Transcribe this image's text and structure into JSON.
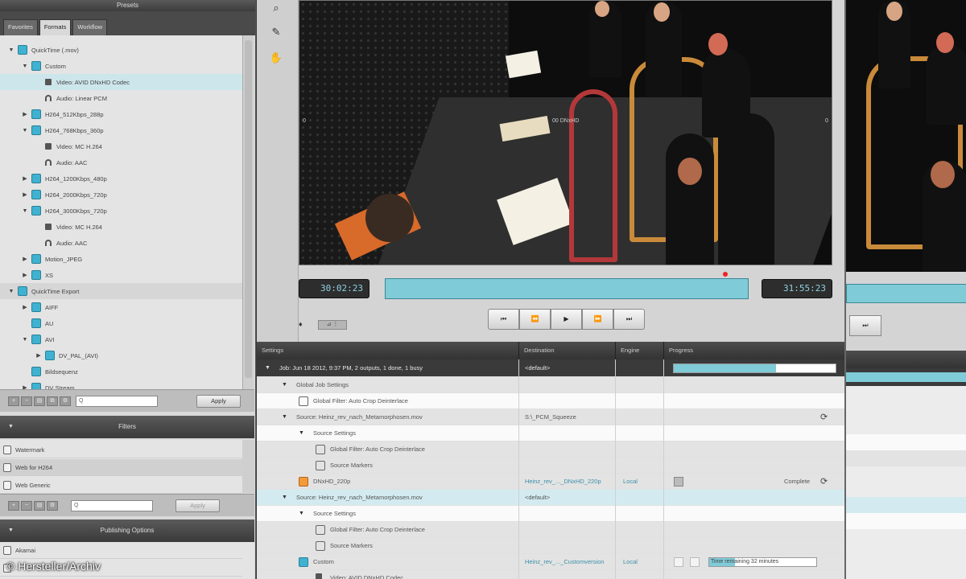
{
  "left": {
    "presets_title": "Presets",
    "tabs": [
      "Favorites",
      "Formats",
      "Workflow"
    ],
    "tree": [
      {
        "label": "QuickTime (.mov)",
        "indent": 0,
        "tri": "▼",
        "icon": "qt"
      },
      {
        "label": "Custom",
        "indent": 1,
        "tri": "▼",
        "icon": "qt"
      },
      {
        "label": "Video: AVID DNxHD Codec",
        "indent": 2,
        "tri": "",
        "icon": "film",
        "selected": true
      },
      {
        "label": "Audio: Linear PCM",
        "indent": 2,
        "tri": "",
        "icon": "audio"
      },
      {
        "label": "H264_512Kbps_288p",
        "indent": 1,
        "tri": "▶",
        "icon": "qt"
      },
      {
        "label": "H264_768Kbps_360p",
        "indent": 1,
        "tri": "▼",
        "icon": "qt"
      },
      {
        "label": "Video: MC H.264",
        "indent": 2,
        "tri": "",
        "icon": "film"
      },
      {
        "label": "Audio: AAC",
        "indent": 2,
        "tri": "",
        "icon": "audio"
      },
      {
        "label": "H264_1200Kbps_480p",
        "indent": 1,
        "tri": "▶",
        "icon": "qt"
      },
      {
        "label": "H264_2000Kbps_720p",
        "indent": 1,
        "tri": "▶",
        "icon": "qt"
      },
      {
        "label": "H264_3000Kbps_720p",
        "indent": 1,
        "tri": "▼",
        "icon": "qt"
      },
      {
        "label": "Video: MC H.264",
        "indent": 2,
        "tri": "",
        "icon": "film"
      },
      {
        "label": "Audio: AAC",
        "indent": 2,
        "tri": "",
        "icon": "audio"
      },
      {
        "label": "Motion_JPEG",
        "indent": 1,
        "tri": "▶",
        "icon": "qt"
      },
      {
        "label": "XS",
        "indent": 1,
        "tri": "▶",
        "icon": "qt"
      },
      {
        "label": "QuickTime Export",
        "indent": 0,
        "tri": "▼",
        "icon": "qt",
        "shade": true
      },
      {
        "label": "AIFF",
        "indent": 1,
        "tri": "▶",
        "icon": "qt"
      },
      {
        "label": "AU",
        "indent": 1,
        "tri": "",
        "icon": "qt"
      },
      {
        "label": "AVI",
        "indent": 1,
        "tri": "▼",
        "icon": "qt"
      },
      {
        "label": "DV_PAL_(AVI)",
        "indent": 2,
        "tri": "▶",
        "icon": "qt"
      },
      {
        "label": "Bildsequenz",
        "indent": 1,
        "tri": "",
        "icon": "qt"
      },
      {
        "label": "DV Stream",
        "indent": 1,
        "tri": "▶",
        "icon": "qt"
      }
    ],
    "toolbar": {
      "search_placeholder": "Q",
      "apply_label": "Apply"
    },
    "filters_title": "Filters",
    "filters": [
      "Watermark",
      "Web for H264",
      "Web Generic"
    ],
    "filters_apply_label": "Apply",
    "publishing_title": "Publishing Options",
    "publishing_items": [
      "Akamai",
      "..."
    ],
    "credit": "© Hersteller/Archiv"
  },
  "viewer": {
    "tools": [
      "zoom-icon",
      "eyedropper-icon",
      "hand-icon"
    ],
    "timecode_in": "30:02:23",
    "timecode_out": "31:55:23",
    "transport": [
      "⏮",
      "⏪",
      "▶",
      "⏩",
      "⏭"
    ],
    "small_ctrl": "♦",
    "small_box": "⊿ ⋮",
    "side_marker_left": "0",
    "side_marker_right": "0",
    "center_label": "00 DNxHD"
  },
  "jobs": {
    "headers": [
      "Settings",
      "Destination",
      "Engine",
      "Progress"
    ],
    "rows": [
      {
        "style": "dark",
        "indent": 0,
        "tri": "▼",
        "icon": "",
        "label": "Job: Jun 18 2012, 9:37 PM, 2 outputs, 1 done, 1 busy",
        "dest": "<default>",
        "engine": "",
        "progress": "bar"
      },
      {
        "style": "grey",
        "indent": 1,
        "tri": "▼",
        "icon": "",
        "label": "Global Job Settings",
        "dest": "",
        "engine": ""
      },
      {
        "style": "white",
        "indent": 2,
        "tri": "",
        "icon": "gear",
        "label": "Global Filter: Auto Crop Deinterlace",
        "dest": "",
        "engine": ""
      },
      {
        "style": "grey",
        "indent": 1,
        "tri": "▼",
        "icon": "",
        "label": "Source: Heinz_rev_nach_Metamorphosen.mov",
        "dest": "S:\\_PCM_Squeeze",
        "engine": "",
        "refresh": true
      },
      {
        "style": "white",
        "indent": 2,
        "tri": "▼",
        "icon": "",
        "label": "Source Settings",
        "dest": "",
        "engine": ""
      },
      {
        "style": "grey",
        "indent": 3,
        "tri": "",
        "icon": "gear",
        "label": "Global Filter: Auto Crop Deinterlace",
        "dest": "",
        "engine": ""
      },
      {
        "style": "grey",
        "indent": 3,
        "tri": "",
        "icon": "gear",
        "label": "Source Markers",
        "dest": "",
        "engine": ""
      },
      {
        "style": "grey",
        "indent": 2,
        "tri": "▶",
        "icon": "orange",
        "label": "DNxHD_220p",
        "dest": "Heinz_rev_..._DNxHD_220p",
        "engine": "Local",
        "status": "Complete"
      },
      {
        "style": "blue",
        "indent": 1,
        "tri": "▼",
        "icon": "",
        "label": "Source: Heinz_rev_nach_Metamorphosen.mov",
        "dest": "<default>",
        "engine": ""
      },
      {
        "style": "white",
        "indent": 2,
        "tri": "▼",
        "icon": "",
        "label": "Source Settings",
        "dest": "",
        "engine": ""
      },
      {
        "style": "grey",
        "indent": 3,
        "tri": "",
        "icon": "gear",
        "label": "Global Filter: Auto Crop Deinterlace",
        "dest": "",
        "engine": ""
      },
      {
        "style": "grey",
        "indent": 3,
        "tri": "",
        "icon": "gear",
        "label": "Source Markers",
        "dest": "",
        "engine": ""
      },
      {
        "style": "grey",
        "indent": 2,
        "tri": "▼",
        "icon": "qt",
        "label": "Custom",
        "dest": "Heinz_rev_..._Customversion",
        "engine": "Local",
        "progress2": "Time remaining 32 minutes"
      },
      {
        "style": "grey",
        "indent": 3,
        "tri": "",
        "icon": "film",
        "label": "Video: AVID DNxHD Codec",
        "dest": "",
        "engine": ""
      }
    ],
    "job_progress": 0.63,
    "encode_progress": 0.24
  },
  "colors": {
    "accent": "#7fcbd8",
    "selection": "#cde6ec",
    "dark": "#3a3a3a"
  }
}
